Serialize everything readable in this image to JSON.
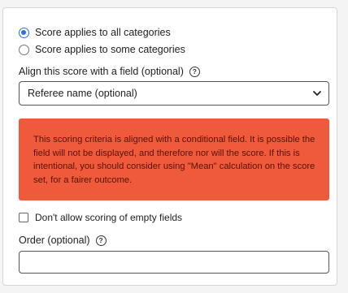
{
  "scope": {
    "options": [
      {
        "label": "Score applies to all categories",
        "selected": true
      },
      {
        "label": "Score applies to some categories",
        "selected": false
      }
    ]
  },
  "align_field": {
    "label": "Align this score with a field (optional)",
    "help_icon": "question-circle-icon",
    "selected_value": "Referee name (optional)"
  },
  "warning": {
    "text": "This scoring criteria is aligned with a conditional field. It is possible the field will not be displayed, and therefore nor will the score. If this is intentional, you should consider using \"Mean\" calculation on the score set, for a fairer outcome.",
    "background": "#ef5a3b",
    "text_color": "#5a1206"
  },
  "empty_fields": {
    "label": "Don't allow scoring of empty fields",
    "checked": false
  },
  "order": {
    "label": "Order (optional)",
    "help_icon": "question-circle-icon",
    "value": ""
  },
  "colors": {
    "accent": "#2f6fe0"
  }
}
